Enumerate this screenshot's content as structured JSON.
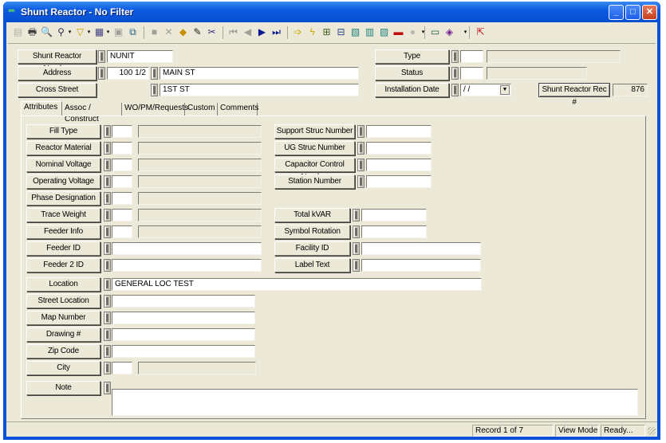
{
  "window": {
    "title": "Shunt Reactor - No Filter",
    "icon": "app-logo-icon",
    "controls": {
      "minimize": "_",
      "maximize": "□",
      "close": "✕"
    }
  },
  "toolbar": {
    "buttons": [
      {
        "name": "form-view-icon",
        "glyph": "▤",
        "color": "#b0b0a8"
      },
      {
        "name": "print-icon",
        "glyph": "🖶",
        "color": "#404040"
      },
      {
        "name": "print-preview-icon",
        "glyph": "🔍",
        "color": "#806000"
      },
      {
        "name": "find-icon",
        "glyph": "⚲",
        "color": "#303050"
      },
      {
        "name": "filter-icon",
        "glyph": "▽",
        "color": "#c8a000"
      },
      {
        "name": "report-icon",
        "glyph": "▦",
        "color": "#404080"
      },
      {
        "name": "properties-icon",
        "glyph": "▣",
        "color": "#a0a098"
      },
      {
        "name": "copy-record-icon",
        "glyph": "⧉",
        "color": "#206080"
      },
      {
        "name": "save-icon",
        "glyph": "■",
        "color": "#a0a098"
      },
      {
        "name": "delete-icon",
        "glyph": "✕",
        "color": "#a0a098"
      },
      {
        "name": "add-record-icon",
        "glyph": "◆",
        "color": "#c89000"
      },
      {
        "name": "edit-icon",
        "glyph": "✎",
        "color": "#202020"
      },
      {
        "name": "cut-icon",
        "glyph": "✂",
        "color": "#303080"
      },
      {
        "name": "first-record-icon",
        "glyph": "⏮",
        "color": "#a0a098"
      },
      {
        "name": "previous-record-icon",
        "glyph": "◀",
        "color": "#a0a098"
      },
      {
        "name": "next-record-icon",
        "glyph": "▶",
        "color": "#0a1a90"
      },
      {
        "name": "last-record-icon",
        "glyph": "⏭",
        "color": "#0a1a90"
      },
      {
        "name": "go-to-icon",
        "glyph": "➩",
        "color": "#c8a800"
      },
      {
        "name": "quick-action-icon",
        "glyph": "ϟ",
        "color": "#c8a800"
      },
      {
        "name": "hierarchy-icon",
        "glyph": "⊞",
        "color": "#406020"
      },
      {
        "name": "network-trace-icon",
        "glyph": "⊟",
        "color": "#204080"
      },
      {
        "name": "map-icon",
        "glyph": "▧",
        "color": "#208080"
      },
      {
        "name": "archive-icon",
        "glyph": "▥",
        "color": "#208080"
      },
      {
        "name": "gis-icon",
        "glyph": "▨",
        "color": "#208080"
      },
      {
        "name": "toolbox-icon",
        "glyph": "▬",
        "color": "#c01010"
      },
      {
        "name": "comment-icon",
        "glyph": "●",
        "color": "#b8b8b0"
      },
      {
        "name": "monitor-icon",
        "glyph": "▭",
        "color": "#206040"
      },
      {
        "name": "book-icon",
        "glyph": "◈",
        "color": "#702090"
      },
      {
        "name": "exit-icon",
        "glyph": "⇱",
        "color": "#c01020"
      }
    ]
  },
  "header": {
    "shunt_reactor_number": {
      "label": "Shunt Reactor Number",
      "value": "NUNIT"
    },
    "address": {
      "label": "Address",
      "number": "100 1/2",
      "street": "MAIN ST"
    },
    "cross_street": {
      "label": "Cross Street",
      "value": "1ST ST"
    },
    "type": {
      "label": "Type",
      "code": "",
      "description": ""
    },
    "status": {
      "label": "Status",
      "code": "",
      "description": ""
    },
    "installation_date": {
      "label": "Installation Date",
      "value": " /  /"
    },
    "rec_number": {
      "label": "Shunt Reactor Rec #",
      "value": "876"
    }
  },
  "tabs": [
    {
      "label": "Attributes",
      "active": true
    },
    {
      "label": "Assoc / Construct",
      "active": false
    },
    {
      "label": "WO/PM/Requests",
      "active": false
    },
    {
      "label": "Custom",
      "active": false
    },
    {
      "label": "Comments",
      "active": false
    }
  ],
  "attributes": {
    "left_coded": [
      {
        "label": "Fill Type",
        "code": "",
        "description": ""
      },
      {
        "label": "Reactor Material",
        "code": "",
        "description": ""
      },
      {
        "label": "Nominal Voltage",
        "code": "",
        "description": ""
      },
      {
        "label": "Operating Voltage",
        "code": "",
        "description": ""
      },
      {
        "label": "Phase Designation",
        "code": "",
        "description": ""
      },
      {
        "label": "Trace Weight",
        "code": "",
        "description": ""
      },
      {
        "label": "Feeder Info",
        "code": "",
        "description": ""
      }
    ],
    "left_text": [
      {
        "label": "Feeder ID",
        "value": ""
      },
      {
        "label": "Feeder 2 ID",
        "value": ""
      }
    ],
    "location": {
      "label": "Location",
      "value": "GENERAL LOC TEST"
    },
    "location_fields": [
      {
        "label": "Street Location",
        "value": ""
      },
      {
        "label": "Map Number",
        "value": ""
      },
      {
        "label": "Drawing #",
        "value": ""
      },
      {
        "label": "Zip Code",
        "value": ""
      }
    ],
    "city": {
      "label": "City",
      "code": "",
      "description": ""
    },
    "note": {
      "label": "Note",
      "value": ""
    },
    "right_struc": [
      {
        "label": "Support Struc Number",
        "value": ""
      },
      {
        "label": "UG Struc Number",
        "value": ""
      },
      {
        "label": "Capacitor Control Number",
        "value": ""
      },
      {
        "label": "Station Number",
        "value": ""
      }
    ],
    "right_short": [
      {
        "label": "Total kVAR",
        "value": ""
      },
      {
        "label": "Symbol Rotation",
        "value": ""
      }
    ],
    "right_long": [
      {
        "label": "Facility ID",
        "value": ""
      },
      {
        "label": "Label Text",
        "value": ""
      }
    ]
  },
  "statusbar": {
    "record": "Record 1 of 7",
    "mode": "View Mode",
    "state": "Ready..."
  }
}
